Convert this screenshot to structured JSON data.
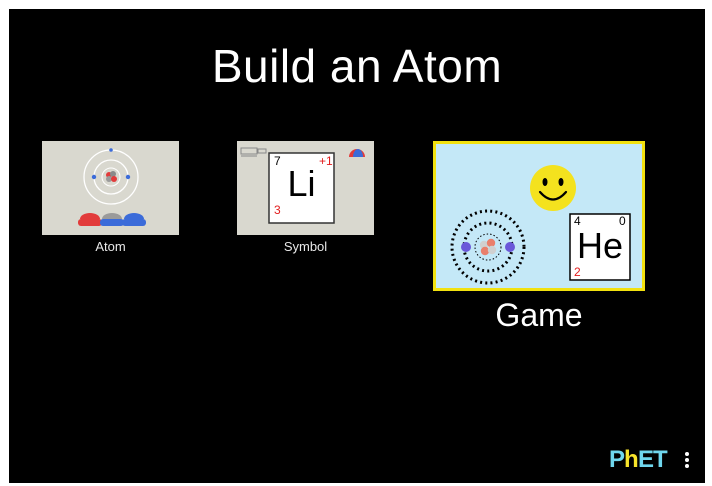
{
  "title": "Build an Atom",
  "screens": [
    {
      "label": "Atom",
      "selected": false
    },
    {
      "label": "Symbol",
      "selected": false,
      "element": {
        "symbol": "Li",
        "mass": "7",
        "charge": "+1",
        "number": "3"
      }
    },
    {
      "label": "Game",
      "selected": true,
      "element": {
        "symbol": "He",
        "mass": "4",
        "charge": "0",
        "number": "2"
      }
    }
  ],
  "logo": {
    "text": "PhET"
  },
  "colors": {
    "background": "#000000",
    "highlight": "#f2e10f",
    "game_bg": "#c4e8f7",
    "thumb_bg": "#d9d8cf",
    "smiley": "#f4e21e",
    "red": "#e21d1d"
  }
}
